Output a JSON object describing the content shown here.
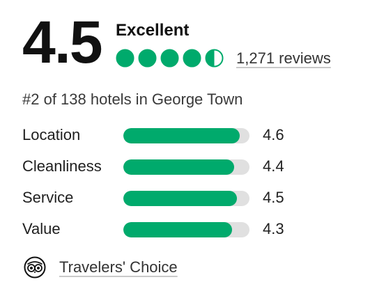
{
  "summary": {
    "score": "4.5",
    "rating_label": "Excellent",
    "bubble_rating": 4.5,
    "bubble_max": 5,
    "reviews_text": "1,271 reviews"
  },
  "ranking_text": "#2 of 138 hotels in George Town",
  "subratings": [
    {
      "label": "Location",
      "value": "4.6",
      "fraction": 0.92
    },
    {
      "label": "Cleanliness",
      "value": "4.4",
      "fraction": 0.88
    },
    {
      "label": "Service",
      "value": "4.5",
      "fraction": 0.9
    },
    {
      "label": "Value",
      "value": "4.3",
      "fraction": 0.86
    }
  ],
  "award": {
    "label": "Travelers' Choice",
    "icon": "owl-icon"
  },
  "colors": {
    "accent": "#00aa6c",
    "track": "#e0e0e0",
    "text": "#1a1a1a"
  }
}
